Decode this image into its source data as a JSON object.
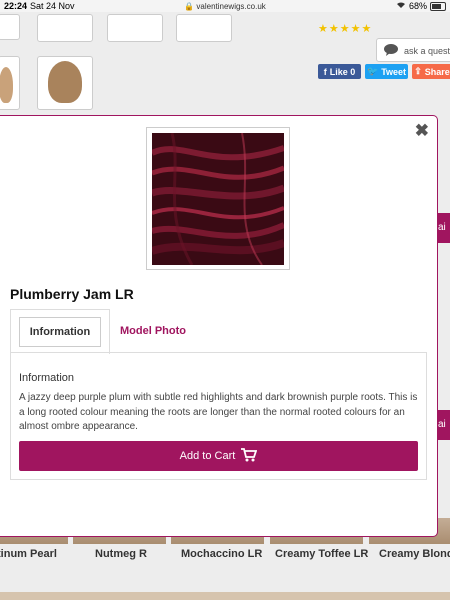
{
  "statusbar": {
    "time": "22:24",
    "date": "Sat 24 Nov",
    "url": "valentinewigs.co.uk",
    "battery": "68%"
  },
  "background": {
    "ask_text": "ask a questi",
    "share": {
      "like_label": "Like 0",
      "tweet_label": "Tweet",
      "share_label": "Share"
    },
    "bottom_names": [
      "tinum Pearl",
      "Nutmeg R",
      "Mochaccino LR",
      "Creamy Toffee LR",
      "Creamy Blonde"
    ],
    "side_tab_text": "ai"
  },
  "modal": {
    "close_icon": "close-icon",
    "title": "Plumberry Jam LR",
    "tabs": [
      "Information",
      "Model Photo"
    ],
    "info_heading": "Information",
    "description": "A jazzy deep purple plum with subtle red highlights and dark brownish purple roots. This is a long rooted colour meaning the roots are longer than the normal rooted colours for an almost ombre appearance.",
    "add_to_cart_label": "Add to Cart",
    "cart_icon": "cart-icon"
  },
  "colors": {
    "accent": "#a0155f",
    "swatch_dark": "#3a0a14",
    "swatch_red": "#a3253f"
  }
}
